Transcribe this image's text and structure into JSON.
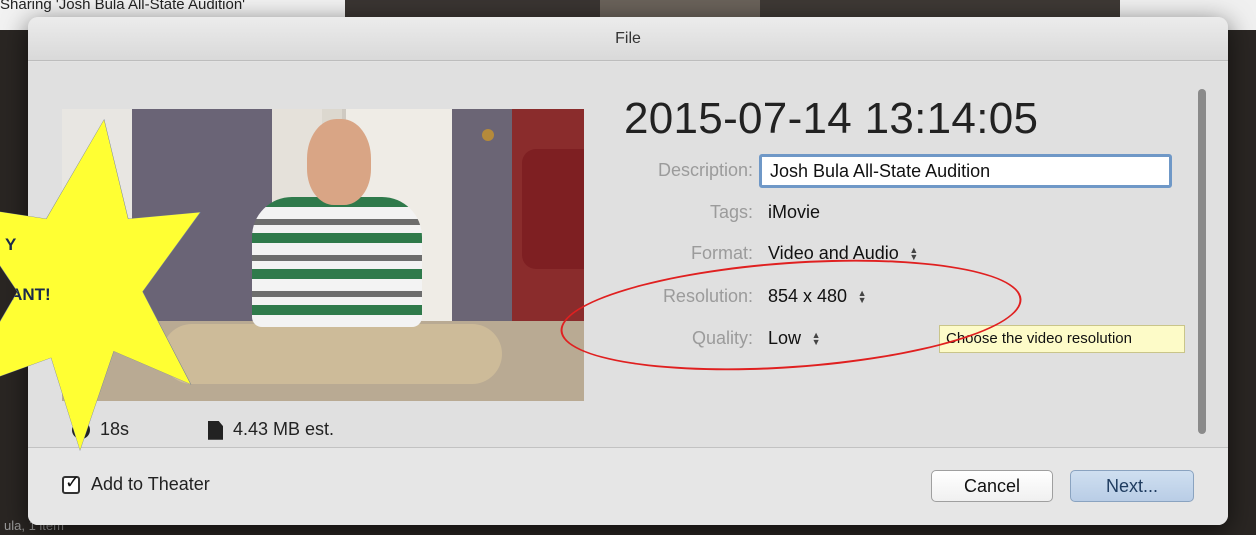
{
  "background": {
    "top_text": "Sharing 'Josh Bula All-State Audition'",
    "bottom_text": "ula, 1 item"
  },
  "dialog": {
    "title": "File",
    "date_title": "2015-07-14 13:14:05",
    "duration": "18s",
    "file_size": "4.43 MB est.",
    "fields": {
      "description_label": "Description:",
      "description_value": "Josh Bula All-State Audition",
      "tags_label": "Tags:",
      "tags_value": "iMovie",
      "format_label": "Format:",
      "format_value": "Video and Audio",
      "resolution_label": "Resolution:",
      "resolution_value": "854 x 480",
      "quality_label": "Quality:",
      "quality_value": "Low"
    },
    "tooltip": "Choose the video resolution",
    "add_to_theater_label": "Add to Theater",
    "add_to_theater_checked": true,
    "cancel_label": "Cancel",
    "next_label": "Next..."
  },
  "annotation": {
    "star_line1": "Y",
    "star_line2": "TANT!",
    "star_color": "#ffff33",
    "ellipse_color": "#e02020"
  },
  "colors": {
    "accent_focus": "#6f98c7",
    "tooltip_bg": "#fdfbc8"
  }
}
